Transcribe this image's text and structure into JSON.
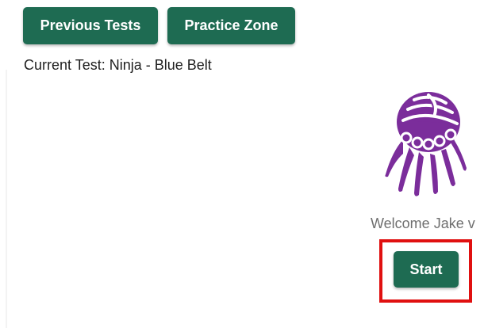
{
  "nav": {
    "previous_tests_label": "Previous Tests",
    "practice_zone_label": "Practice Zone"
  },
  "test": {
    "current_test_text": "Current Test: Ninja - Blue Belt"
  },
  "welcome": {
    "text": "Welcome Jake v",
    "start_label": "Start"
  },
  "theme": {
    "accent": "#1e6b52",
    "mascot_color": "#7b2d9b",
    "highlight_color": "#e01010"
  },
  "icons": {
    "mascot": "purple-octopus-mascot-icon"
  }
}
